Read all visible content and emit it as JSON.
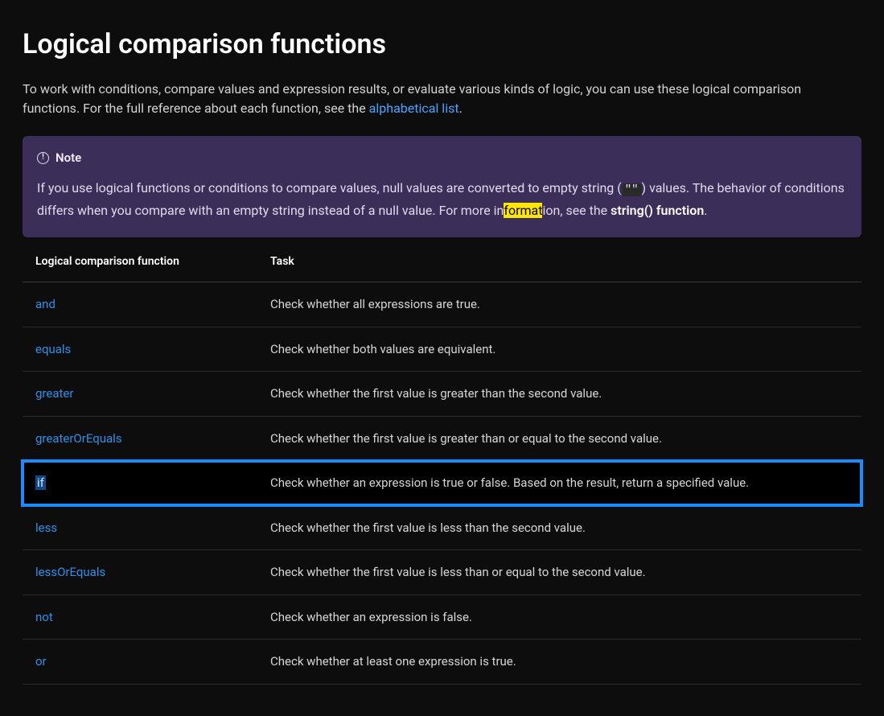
{
  "heading": "Logical comparison functions",
  "intro_before_link": "To work with conditions, compare values and expression results, or evaluate various kinds of logic, you can use these logical comparison functions. For the full reference about each function, see the ",
  "intro_link": "alphabetical list",
  "intro_after_link": ".",
  "note": {
    "label": "Note",
    "body_part1": "If you use logical functions or conditions to compare values, null values are converted to empty string (",
    "code_chip": "\"\"",
    "body_part2": ") values. The behavior of conditions differs when you compare with an empty string instead of a null value. For more in",
    "highlighted_fragment": "format",
    "body_part3": "ion, see the ",
    "strong_text": "string() function",
    "body_part4": "."
  },
  "table": {
    "headers": {
      "fn": "Logical comparison function",
      "task": "Task"
    },
    "rows": [
      {
        "fn": "and",
        "task": "Check whether all expressions are true.",
        "highlight": false
      },
      {
        "fn": "equals",
        "task": "Check whether both values are equivalent.",
        "highlight": false
      },
      {
        "fn": "greater",
        "task": "Check whether the first value is greater than the second value.",
        "highlight": false
      },
      {
        "fn": "greaterOrEquals",
        "task": "Check whether the first value is greater than or equal to the second value.",
        "highlight": false
      },
      {
        "fn": "if",
        "task": "Check whether an expression is true or false. Based on the result, return a specified value.",
        "highlight": true
      },
      {
        "fn": "less",
        "task": "Check whether the first value is less than the second value.",
        "highlight": false
      },
      {
        "fn": "lessOrEquals",
        "task": "Check whether the first value is less than or equal to the second value.",
        "highlight": false
      },
      {
        "fn": "not",
        "task": "Check whether an expression is false.",
        "highlight": false
      },
      {
        "fn": "or",
        "task": "Check whether at least one expression is true.",
        "highlight": false
      }
    ]
  }
}
